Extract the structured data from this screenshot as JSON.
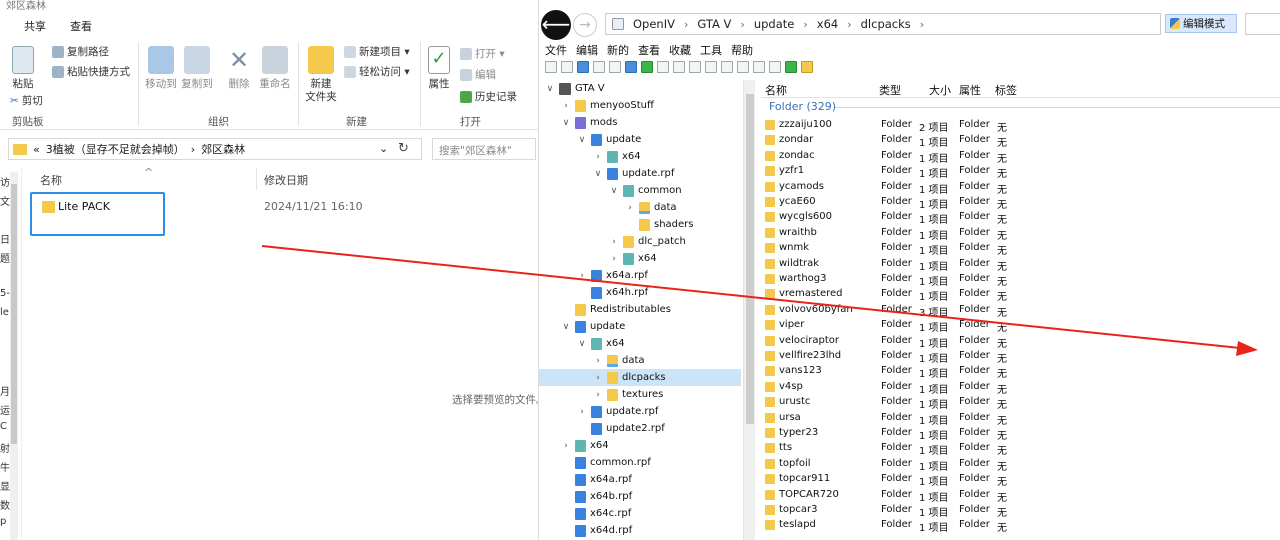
{
  "explorer": {
    "title": "郊区森林",
    "tabs": [
      "共享",
      "查看"
    ],
    "ribbon": {
      "copy_path": "复制路径",
      "paste_shortcut": "粘贴快捷方式",
      "paste": "粘贴",
      "cut": "剪切",
      "clipboard_group": "剪贴板",
      "move_to": "移动到",
      "copy_to": "复制到",
      "delete": "删除",
      "rename": "重命名",
      "organize_group": "组织",
      "new_folder_l1": "新建",
      "new_folder_l2": "文件夹",
      "new_item": "新建项目 ▾",
      "easy_access": "轻松访问 ▾",
      "new_group": "新建",
      "properties": "属性",
      "open": "打开 ▾",
      "edit": "编辑",
      "history": "历史记录",
      "open_group": "打开"
    },
    "address": {
      "prefix": "«",
      "seg1": "3植被（显存不足就会掉帧）",
      "sep": "›",
      "seg2": "郊区森林",
      "dropdown": "⌄",
      "refresh": "↻"
    },
    "search_placeholder": "搜索\"郊区森林\"",
    "leftnav": [
      "访",
      "文",
      "",
      "日",
      "题",
      "",
      "5-",
      "le",
      "",
      "",
      "",
      "月",
      "运",
      "C",
      "射",
      "牛",
      "显",
      "数",
      "p"
    ],
    "columns": {
      "name": "名称",
      "date": "修改日期",
      "sort_arrow": "^"
    },
    "file": {
      "name": "Lite PACK",
      "date": "2024/11/21 16:10"
    },
    "preview_text": "选择要预览的文件。"
  },
  "openiv": {
    "breadcrumb": [
      "OpenIV",
      "GTA V",
      "update",
      "x64",
      "dlcpacks"
    ],
    "crumb_sep": "›",
    "edit_mode": "编辑模式",
    "menu": [
      "文件",
      "编辑",
      "新的",
      "查看",
      "收藏",
      "工具",
      "帮助"
    ],
    "tree": [
      {
        "label": "GTA V",
        "depth": 0,
        "chev": "∨",
        "icon": "gta"
      },
      {
        "label": "menyooStuff",
        "depth": 1,
        "chev": "›",
        "icon": "folder"
      },
      {
        "label": "mods",
        "depth": 1,
        "chev": "∨",
        "icon": "purple"
      },
      {
        "label": "update",
        "depth": 2,
        "chev": "∨",
        "icon": "blue"
      },
      {
        "label": "x64",
        "depth": 3,
        "chev": "›",
        "icon": "teal"
      },
      {
        "label": "update.rpf",
        "depth": 3,
        "chev": "∨",
        "icon": "blue"
      },
      {
        "label": "common",
        "depth": 4,
        "chev": "∨",
        "icon": "teal"
      },
      {
        "label": "data",
        "depth": 5,
        "chev": "›",
        "icon": "picfolder"
      },
      {
        "label": "shaders",
        "depth": 5,
        "chev": "",
        "icon": "folder"
      },
      {
        "label": "dlc_patch",
        "depth": 4,
        "chev": "›",
        "icon": "folder"
      },
      {
        "label": "x64",
        "depth": 4,
        "chev": "›",
        "icon": "teal"
      },
      {
        "label": "x64a.rpf",
        "depth": 2,
        "chev": "›",
        "icon": "blue"
      },
      {
        "label": "x64h.rpf",
        "depth": 2,
        "chev": "",
        "icon": "blue"
      },
      {
        "label": "Redistributables",
        "depth": 1,
        "chev": "",
        "icon": "folder"
      },
      {
        "label": "update",
        "depth": 1,
        "chev": "∨",
        "icon": "blue"
      },
      {
        "label": "x64",
        "depth": 2,
        "chev": "∨",
        "icon": "teal"
      },
      {
        "label": "data",
        "depth": 3,
        "chev": "›",
        "icon": "picfolder"
      },
      {
        "label": "dlcpacks",
        "depth": 3,
        "chev": "›",
        "icon": "folder",
        "selected": true
      },
      {
        "label": "textures",
        "depth": 3,
        "chev": "›",
        "icon": "folder"
      },
      {
        "label": "update.rpf",
        "depth": 2,
        "chev": "›",
        "icon": "blue"
      },
      {
        "label": "update2.rpf",
        "depth": 2,
        "chev": "",
        "icon": "blue"
      },
      {
        "label": "x64",
        "depth": 1,
        "chev": "›",
        "icon": "teal"
      },
      {
        "label": "common.rpf",
        "depth": 1,
        "chev": "",
        "icon": "blue"
      },
      {
        "label": "x64a.rpf",
        "depth": 1,
        "chev": "",
        "icon": "blue"
      },
      {
        "label": "x64b.rpf",
        "depth": 1,
        "chev": "",
        "icon": "blue"
      },
      {
        "label": "x64c.rpf",
        "depth": 1,
        "chev": "",
        "icon": "blue"
      },
      {
        "label": "x64d.rpf",
        "depth": 1,
        "chev": "",
        "icon": "blue"
      }
    ],
    "list_columns": [
      "名称",
      "类型",
      "大小",
      "属性",
      "标签"
    ],
    "group_header": "Folder (329)",
    "rows": [
      [
        "zzzaiju100",
        "Folder",
        "2 项目",
        "Folder",
        "无"
      ],
      [
        "zondar",
        "Folder",
        "1 项目",
        "Folder",
        "无"
      ],
      [
        "zondac",
        "Folder",
        "1 项目",
        "Folder",
        "无"
      ],
      [
        "yzfr1",
        "Folder",
        "1 项目",
        "Folder",
        "无"
      ],
      [
        "ycamods",
        "Folder",
        "1 项目",
        "Folder",
        "无"
      ],
      [
        "ycaE60",
        "Folder",
        "1 项目",
        "Folder",
        "无"
      ],
      [
        "wycgls600",
        "Folder",
        "1 项目",
        "Folder",
        "无"
      ],
      [
        "wraithb",
        "Folder",
        "1 项目",
        "Folder",
        "无"
      ],
      [
        "wnmk",
        "Folder",
        "1 项目",
        "Folder",
        "无"
      ],
      [
        "wildtrak",
        "Folder",
        "1 项目",
        "Folder",
        "无"
      ],
      [
        "warthog3",
        "Folder",
        "1 项目",
        "Folder",
        "无"
      ],
      [
        "vremastered",
        "Folder",
        "1 项目",
        "Folder",
        "无"
      ],
      [
        "volvov60byfan",
        "Folder",
        "3 项目",
        "Folder",
        "无"
      ],
      [
        "viper",
        "Folder",
        "1 项目",
        "Folder",
        "无"
      ],
      [
        "velociraptor",
        "Folder",
        "1 项目",
        "Folder",
        "无"
      ],
      [
        "vellfire23lhd",
        "Folder",
        "1 项目",
        "Folder",
        "无"
      ],
      [
        "vans123",
        "Folder",
        "1 项目",
        "Folder",
        "无"
      ],
      [
        "v4sp",
        "Folder",
        "1 项目",
        "Folder",
        "无"
      ],
      [
        "urustc",
        "Folder",
        "1 项目",
        "Folder",
        "无"
      ],
      [
        "ursa",
        "Folder",
        "1 项目",
        "Folder",
        "无"
      ],
      [
        "typer23",
        "Folder",
        "1 项目",
        "Folder",
        "无"
      ],
      [
        "tts",
        "Folder",
        "1 项目",
        "Folder",
        "无"
      ],
      [
        "topfoil",
        "Folder",
        "1 项目",
        "Folder",
        "无"
      ],
      [
        "topcar911",
        "Folder",
        "1 项目",
        "Folder",
        "无"
      ],
      [
        "TOPCAR720",
        "Folder",
        "1 项目",
        "Folder",
        "无"
      ],
      [
        "topcar3",
        "Folder",
        "1 项目",
        "Folder",
        "无"
      ],
      [
        "teslapd",
        "Folder",
        "1 项目",
        "Folder",
        "无"
      ]
    ]
  },
  "annotation": {
    "arrow_color": "#e8241a"
  }
}
